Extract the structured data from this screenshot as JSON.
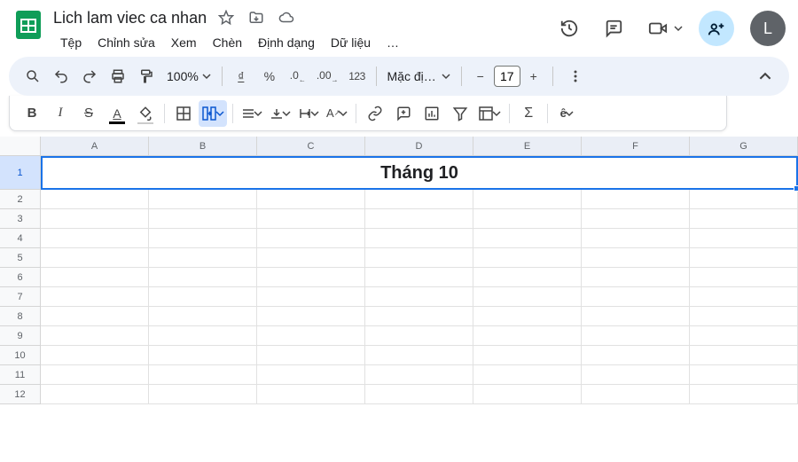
{
  "doc": {
    "title": "Lich lam viec ca nhan"
  },
  "menus": [
    "Tệp",
    "Chỉnh sửa",
    "Xem",
    "Chèn",
    "Định dạng",
    "Dữ liệu",
    "…"
  ],
  "avatar_letter": "L",
  "toolbar": {
    "zoom": "100%",
    "currency": "₫",
    "percent": "%",
    "dec_dec": ".0",
    "dec_inc": ".00",
    "format123": "123",
    "font_name": "Mặc đị…",
    "font_size": "17"
  },
  "toolbar2": {
    "bold": "B",
    "italic": "I",
    "strike": "S",
    "sigma": "Σ",
    "ehat": "ê"
  },
  "grid": {
    "columns": [
      "A",
      "B",
      "C",
      "D",
      "E",
      "F",
      "G"
    ],
    "rows": [
      "1",
      "2",
      "3",
      "4",
      "5",
      "6",
      "7",
      "8",
      "9",
      "10",
      "11",
      "12"
    ],
    "merged_cell_value": "Tháng 10"
  },
  "colors": {
    "text_color_underline": "#000000",
    "fill_color_underline": "#ffffff"
  }
}
